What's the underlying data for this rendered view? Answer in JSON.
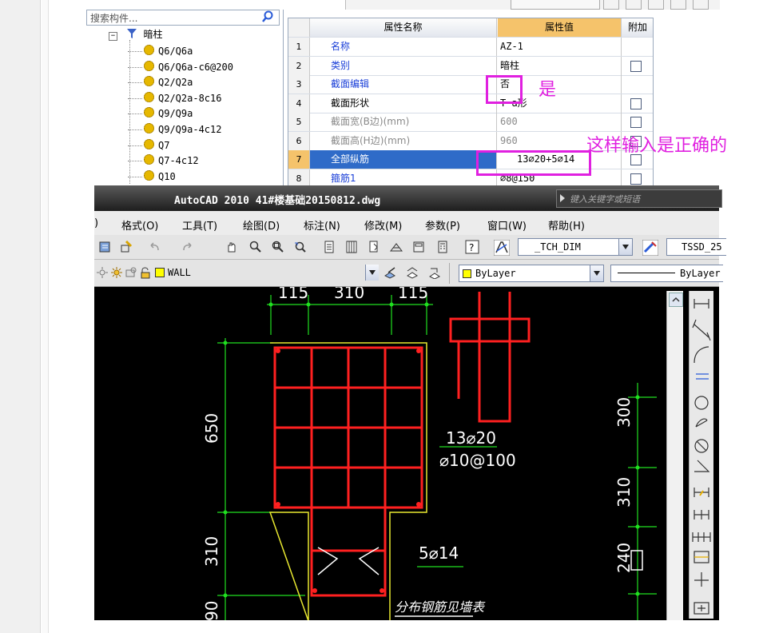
{
  "tree": {
    "search_placeholder": "搜索构件...",
    "root_label": "暗柱",
    "items": [
      "Q6/Q6a",
      "Q6/Q6a-c6@200",
      "Q2/Q2a",
      "Q2/Q2a-8c16",
      "Q9/Q9a",
      "Q9/Q9a-4c12",
      "Q7",
      "Q7-4c12",
      "Q10"
    ]
  },
  "grid": {
    "headers": {
      "name": "属性名称",
      "value": "属性值",
      "extra": "附加"
    },
    "rows": [
      {
        "no": "1",
        "name": "名称",
        "value": "AZ-1",
        "style": "blue",
        "check": false
      },
      {
        "no": "2",
        "name": "类别",
        "value": "暗柱",
        "style": "blue",
        "check": true
      },
      {
        "no": "3",
        "name": "截面编辑",
        "value": "否",
        "style": "blue",
        "check": false
      },
      {
        "no": "4",
        "name": "截面形状",
        "value": "T-a形",
        "style": "black",
        "check": true
      },
      {
        "no": "5",
        "name": "截面宽(B边)(mm)",
        "value": "600",
        "style": "gray",
        "check": true
      },
      {
        "no": "6",
        "name": "截面高(H边)(mm)",
        "value": "960",
        "style": "gray",
        "check": true
      },
      {
        "no": "7",
        "name": "全部纵筋",
        "value": "13⌀20+5⌀14",
        "style": "selected",
        "check": true
      },
      {
        "no": "8",
        "name": "箍筋1",
        "value": "⌀8@150",
        "style": "blue",
        "check": true
      }
    ]
  },
  "annotations": {
    "yes_label": "是",
    "correct_label": "这样输入是正确的",
    "color": "#e020e0"
  },
  "autocad": {
    "title": "AutoCAD 2010   41#楼基础20150812.dwg",
    "search_placeholder": "键入关键字或短语",
    "menus": [
      "格式(O)",
      "工具(T)",
      "绘图(D)",
      "标注(N)",
      "修改(M)",
      "参数(P)",
      "窗口(W)",
      "帮助(H)"
    ],
    "dim_style": "_TCH_DIM",
    "text_style": "TSSD_25",
    "layer": "WALL",
    "color_combo": "ByLayer",
    "linetype": "ByLayer"
  },
  "drawing": {
    "top_dims": [
      "115",
      "310",
      "115"
    ],
    "left_dims": [
      "650",
      "310",
      "90"
    ],
    "right_dims": [
      "300",
      "310",
      "240"
    ],
    "rebar_main": "13⌀20",
    "stirrup": "⌀10@100",
    "rebar_branch": "5⌀14",
    "note": "分布钢筋见墙表",
    "colors": {
      "rebar": "#ff2020",
      "dim": "#20e020",
      "outline": "#e8e830",
      "text": "#ffffff"
    }
  }
}
